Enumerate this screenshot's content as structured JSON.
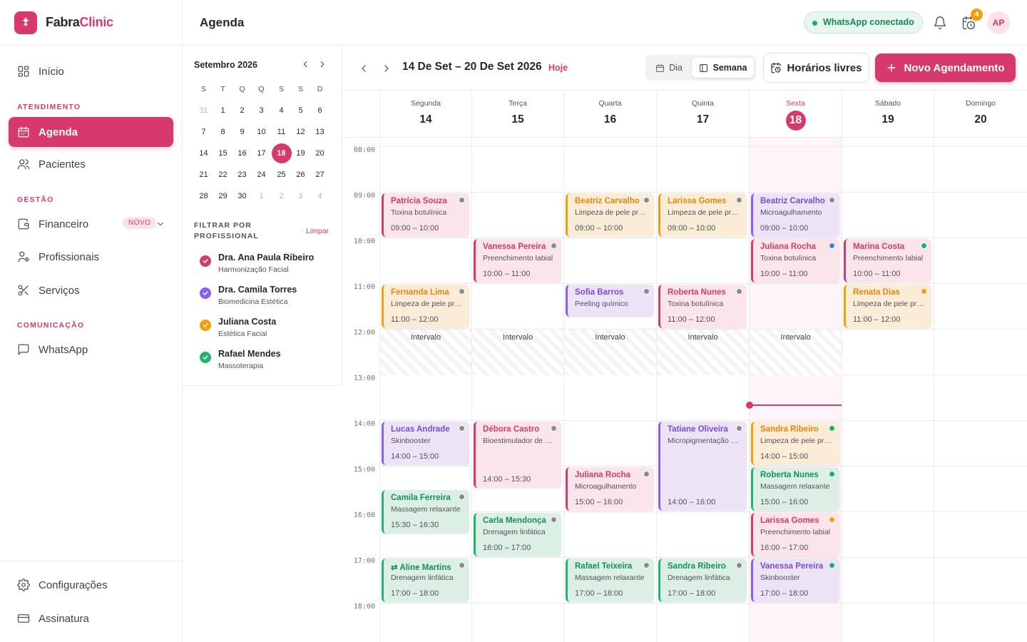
{
  "brand": {
    "name_a": "Fabra",
    "name_b": "Clinic"
  },
  "header": {
    "title": "Agenda",
    "whatsapp_status": "WhatsApp conectado",
    "alarm_count": "4",
    "avatar": "AP"
  },
  "sidebar": {
    "inicio": "Início",
    "sec_atendimento": "ATENDIMENTO",
    "agenda": "Agenda",
    "pacientes": "Pacientes",
    "sec_gestao": "GESTÃO",
    "financeiro": "Financeiro",
    "novo_badge": "NOVO",
    "profissionais": "Profissionais",
    "servicos": "Serviços",
    "sec_comunicacao": "COMUNICAÇÃO",
    "whatsapp": "WhatsApp",
    "configuracoes": "Configurações",
    "assinatura": "Assinatura"
  },
  "mini_calendar": {
    "month": "Setembro 2026",
    "dow": [
      "S",
      "T",
      "Q",
      "Q",
      "S",
      "S",
      "D"
    ],
    "weeks": [
      [
        "31",
        "1",
        "2",
        "3",
        "4",
        "5",
        "6"
      ],
      [
        "7",
        "8",
        "9",
        "10",
        "11",
        "12",
        "13"
      ],
      [
        "14",
        "15",
        "16",
        "17",
        "18",
        "19",
        "20"
      ],
      [
        "21",
        "22",
        "23",
        "24",
        "25",
        "26",
        "27"
      ],
      [
        "28",
        "29",
        "30",
        "1",
        "2",
        "3",
        "4"
      ]
    ],
    "today": "18"
  },
  "filter": {
    "title": "FILTRAR POR PROFISSIONAL",
    "clear": "Limpar",
    "professionals": [
      {
        "name": "Dra. Ana Paula Ribeiro",
        "role": "Harmonização Facial",
        "color": "#d63a6c"
      },
      {
        "name": "Dra. Camila Torres",
        "role": "Biomedicina Estética",
        "color": "#8b5cf6"
      },
      {
        "name": "Juliana Costa",
        "role": "Estética Facial",
        "color": "#f59e0b"
      },
      {
        "name": "Rafael Mendes",
        "role": "Massoterapia",
        "color": "#22b46e"
      }
    ]
  },
  "toolbar": {
    "range": "14 De Set – 20 De Set 2026",
    "today": "Hoje",
    "view_day": "Dia",
    "view_week": "Semana",
    "free_slots": "Horários livres",
    "new_appointment": "Novo Agendamento"
  },
  "days": [
    {
      "name": "Segunda",
      "num": "14"
    },
    {
      "name": "Terça",
      "num": "15"
    },
    {
      "name": "Quarta",
      "num": "16"
    },
    {
      "name": "Quinta",
      "num": "17"
    },
    {
      "name": "Sexta",
      "num": "18",
      "today": true
    },
    {
      "name": "Sábado",
      "num": "19"
    },
    {
      "name": "Domingo",
      "num": "20"
    }
  ],
  "hours": [
    "08:00",
    "09:00",
    "10:00",
    "11:00",
    "12:00",
    "13:00",
    "14:00",
    "15:00",
    "16:00",
    "17:00",
    "18:00"
  ],
  "break_label": "Intervalo",
  "break_days": [
    0,
    1,
    2,
    3,
    4
  ],
  "events": [
    {
      "day": 0,
      "start": 9,
      "end": 10,
      "name": "Patrícia Souza",
      "service": "Toxina botulínica",
      "time": "09:00 – 10:00",
      "color": "pink",
      "dot": "#8a8a93"
    },
    {
      "day": 0,
      "start": 11,
      "end": 12,
      "name": "Fernanda Lima",
      "service": "Limpeza de pele profunda",
      "time": "11:00 – 12:00",
      "color": "orange",
      "dot": "#8a8a93"
    },
    {
      "day": 0,
      "start": 14,
      "end": 15,
      "name": "Lucas Andrade",
      "service": "Skinbooster",
      "time": "14:00 – 15:00",
      "color": "purple",
      "dot": "#8a8a93"
    },
    {
      "day": 0,
      "start": 15.5,
      "end": 16.5,
      "name": "Camila Ferreira",
      "service": "Massagem relaxante",
      "time": "15:30 – 16:30",
      "color": "green",
      "dot": "#8a8a93"
    },
    {
      "day": 0,
      "start": 17,
      "end": 18,
      "name": "Aline Martins",
      "service": "Drenagem linfática",
      "time": "17:00 – 18:00",
      "color": "green",
      "dot": "#8a8a93",
      "recurring": true
    },
    {
      "day": 1,
      "start": 10,
      "end": 11,
      "name": "Vanessa Pereira",
      "service": "Preenchimento labial",
      "time": "10:00 – 11:00",
      "color": "pink",
      "dot": "#8a8a93"
    },
    {
      "day": 1,
      "start": 14,
      "end": 15.5,
      "name": "Débora Castro",
      "service": "Bioestimulador de colágeno",
      "time": "14:00 – 15:30",
      "color": "pink",
      "dot": "#8a8a93"
    },
    {
      "day": 1,
      "start": 16,
      "end": 17,
      "name": "Carla Mendonça",
      "service": "Drenagem linfática",
      "time": "16:00 – 17:00",
      "color": "green",
      "dot": "#8a8a93"
    },
    {
      "day": 2,
      "start": 9,
      "end": 10,
      "name": "Beatriz Carvalho",
      "service": "Limpeza de pele profunda",
      "time": "09:00 – 10:00",
      "color": "orange",
      "dot": "#8a8a93"
    },
    {
      "day": 2,
      "start": 11,
      "end": 11.75,
      "name": "Sofia Barros",
      "service": "Peeling químico",
      "time": "",
      "color": "purple",
      "dot": "#8a8a93"
    },
    {
      "day": 2,
      "start": 15,
      "end": 16,
      "name": "Juliana Rocha",
      "service": "Microagulhamento",
      "time": "15:00 – 16:00",
      "color": "pink",
      "dot": "#8a8a93"
    },
    {
      "day": 2,
      "start": 17,
      "end": 18,
      "name": "Rafael Teixeira",
      "service": "Massagem relaxante",
      "time": "17:00 – 18:00",
      "color": "green",
      "dot": "#8a8a93"
    },
    {
      "day": 3,
      "start": 9,
      "end": 10,
      "name": "Larissa Gomes",
      "service": "Limpeza de pele profunda",
      "time": "09:00 – 10:00",
      "color": "orange",
      "dot": "#8a8a93"
    },
    {
      "day": 3,
      "start": 11,
      "end": 12,
      "name": "Roberta Nunes",
      "service": "Toxina botulínica",
      "time": "11:00 – 12:00",
      "color": "pink",
      "dot": "#8a8a93"
    },
    {
      "day": 3,
      "start": 14,
      "end": 16,
      "name": "Tatiane Oliveira",
      "service": "Micropigmentação de sobrancelha",
      "time": "14:00 – 16:00",
      "color": "purple",
      "dot": "#8a8a93"
    },
    {
      "day": 3,
      "start": 17,
      "end": 18,
      "name": "Sandra Ribeiro",
      "service": "Drenagem linfática",
      "time": "17:00 – 18:00",
      "color": "green",
      "dot": "#8a8a93"
    },
    {
      "day": 4,
      "start": 9,
      "end": 10,
      "name": "Beatriz Carvalho",
      "service": "Microagulhamento",
      "time": "09:00 – 10:00",
      "color": "purple",
      "dot": "#8a8a93"
    },
    {
      "day": 4,
      "start": 10,
      "end": 11,
      "name": "Juliana Rocha",
      "service": "Toxina botulínica",
      "time": "10:00 – 11:00",
      "color": "pink",
      "dot": "#3b82f6"
    },
    {
      "day": 4,
      "start": 14,
      "end": 15,
      "name": "Sandra Ribeiro",
      "service": "Limpeza de pele profunda",
      "time": "14:00 – 15:00",
      "color": "orange",
      "dot": "#16b16a"
    },
    {
      "day": 4,
      "start": 15,
      "end": 16,
      "name": "Roberta Nunes",
      "service": "Massagem relaxante",
      "time": "15:00 – 16:00",
      "color": "green",
      "dot": "#16b16a"
    },
    {
      "day": 4,
      "start": 16,
      "end": 17,
      "name": "Larissa Gomes",
      "service": "Preenchimento labial",
      "time": "16:00 – 17:00",
      "color": "pink",
      "dot": "#f59e0b"
    },
    {
      "day": 4,
      "start": 17,
      "end": 18,
      "name": "Vanessa Pereira",
      "service": "Skinbooster",
      "time": "17:00 – 18:00",
      "color": "purple",
      "dot": "#16b16a"
    },
    {
      "day": 5,
      "start": 10,
      "end": 11,
      "name": "Marina Costa",
      "service": "Preenchimento labial",
      "time": "10:00 – 11:00",
      "color": "pink",
      "dot": "#16b16a"
    },
    {
      "day": 5,
      "start": 11,
      "end": 12,
      "name": "Renata Dias",
      "service": "Limpeza de pele profunda",
      "time": "11:00 – 12:00",
      "color": "orange",
      "dot": "#f59e0b"
    }
  ]
}
